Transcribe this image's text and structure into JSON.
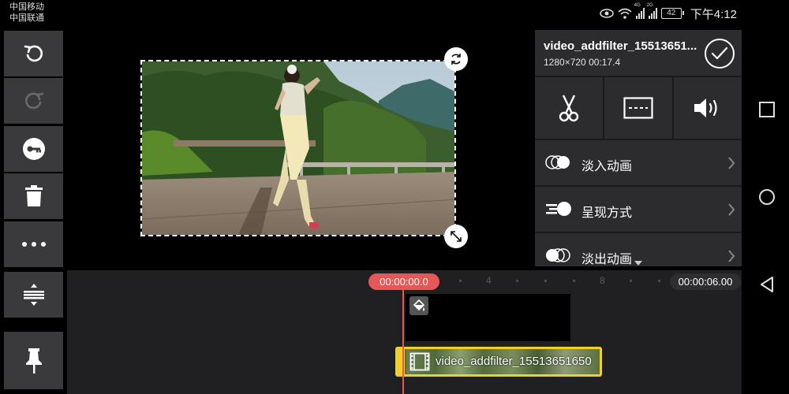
{
  "status_bar": {
    "carrier_1": "中国移动",
    "carrier_2": "中国联通",
    "signal_1_tag": "4G",
    "signal_2_tag": "2G",
    "battery": "42",
    "time": "下午4:12"
  },
  "left_toolbar": {
    "icons": [
      "undo-icon",
      "redo-icon",
      "keyframe-key-icon",
      "trash-icon",
      "more-dots-icon",
      "layer-arrange-icon",
      "pin-icon"
    ]
  },
  "preview": {
    "rotate_handle_icon": "rotate-icon",
    "resize_handle_icon": "resize-icon"
  },
  "clip_panel": {
    "file_name": "video_addfilter_15513651...",
    "resolution": "1280×720",
    "duration": "00:17.4",
    "actions": [
      "scissors-icon",
      "split-frame-icon",
      "volume-icon"
    ],
    "menu": [
      {
        "label": "淡入动画",
        "icon": "fade-in-icon"
      },
      {
        "label": "呈现方式",
        "icon": "motion-icon"
      },
      {
        "label": "淡出动画",
        "icon": "fade-out-icon"
      }
    ]
  },
  "timeline": {
    "current_time": "00:00:00.0",
    "total_time": "00:00:06.00",
    "ruler_labels": [
      "4",
      "8"
    ],
    "video_clip_label": "video_addfilter_15513651650"
  },
  "colors": {
    "accent_red": "#e65757",
    "clip_highlight": "#f0d020",
    "panel_bg": "#2c2c2f",
    "toolbar_bg": "#3a3a3d"
  }
}
